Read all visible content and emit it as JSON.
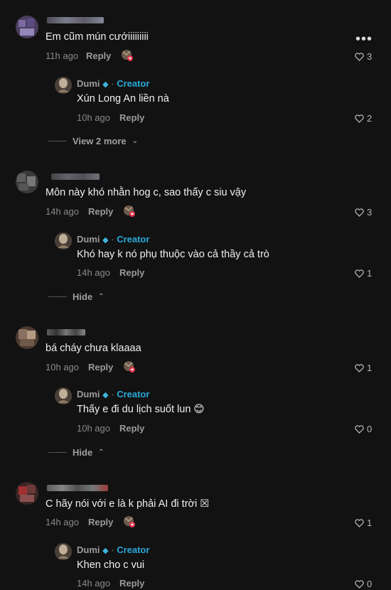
{
  "comments": [
    {
      "text": "Em cũm mún cướiiiiiiiii",
      "time": "11h ago",
      "reply": "Reply",
      "likes": "3",
      "creator_reply": {
        "name": "Dumi",
        "dot": "·",
        "badge": "Creator",
        "text": "Xún Long An liền nà",
        "time": "10h ago",
        "reply": "Reply",
        "likes": "2"
      },
      "toggle": "View 2 more"
    },
    {
      "text": "Môn này khó nhằn hog c, sao thấy c siu vậy",
      "time": "14h ago",
      "reply": "Reply",
      "likes": "3",
      "creator_reply": {
        "name": "Dumi",
        "dot": "·",
        "badge": "Creator",
        "text": "Khó hay k nó phụ thuộc vào cả thầy cả trò",
        "time": "14h ago",
        "reply": "Reply",
        "likes": "1"
      },
      "toggle": "Hide"
    },
    {
      "text": "bá cháy chưa klaaaa",
      "time": "10h ago",
      "reply": "Reply",
      "likes": "1",
      "creator_reply": {
        "name": "Dumi",
        "dot": "·",
        "badge": "Creator",
        "text": "Thấy e đi du lịch suốt lun 😊",
        "time": "10h ago",
        "reply": "Reply",
        "likes": "0"
      },
      "toggle": "Hide"
    },
    {
      "text": "C hãy nói với e là k phải AI đi trời ☒",
      "time": "14h ago",
      "reply": "Reply",
      "likes": "1",
      "creator_reply": {
        "name": "Dumi",
        "dot": "·",
        "badge": "Creator",
        "text": "Khen cho c vui",
        "time": "14h ago",
        "reply": "Reply",
        "likes": "0"
      }
    }
  ],
  "more_menu": "•••",
  "colors": {
    "background": "#121212",
    "creator_badge": "#2aa9d8",
    "notification_dot": "#e0364f"
  }
}
